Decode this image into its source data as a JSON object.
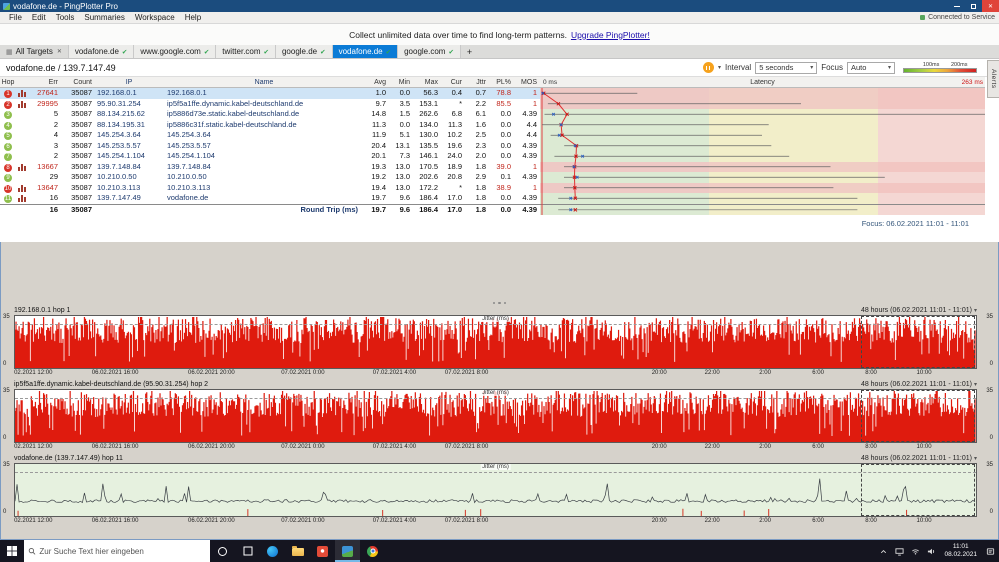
{
  "window": {
    "title": "vodafone.de - PingPlotter Pro",
    "connection_status": "Connected to Service"
  },
  "icons": {
    "close": "✕",
    "check": "✔",
    "caret": "▾",
    "grid": "▦"
  },
  "menu": [
    "File",
    "Edit",
    "Tools",
    "Summaries",
    "Workspace",
    "Help"
  ],
  "banner": {
    "text": "Collect unlimited data over time to find long-term patterns.",
    "link": "Upgrade PingPlotter!"
  },
  "tabs": {
    "all_targets": "All Targets",
    "add_label": "+",
    "items": [
      {
        "label": "vodafone.de",
        "active": false
      },
      {
        "label": "www.google.com",
        "active": false
      },
      {
        "label": "twitter.com",
        "active": false
      },
      {
        "label": "google.de",
        "active": false
      },
      {
        "label": "vodafone.de",
        "active": true
      },
      {
        "label": "google.com",
        "active": false
      }
    ]
  },
  "target": {
    "title": "vodafone.de / 139.7.147.49",
    "interval_label": "Interval",
    "interval_value": "5 seconds",
    "focus_label": "Focus",
    "focus_value": "Auto",
    "legend_100": "100ms",
    "legend_200": "200ms",
    "alerts_tab": "Alerts"
  },
  "table": {
    "headers": [
      "Hop",
      "Err",
      "Count",
      "IP",
      "Name",
      "Avg",
      "Min",
      "Max",
      "Cur",
      "Jttr",
      "PL%",
      "MOS"
    ],
    "latency_header": {
      "title": "Latency",
      "min_label": "0 ms",
      "max_label": "263 ms"
    },
    "scale_max_ms": 263,
    "rows": [
      {
        "hop": "1",
        "err": "27641",
        "count": "35087",
        "ip": "192.168.0.1",
        "name": "192.168.0.1",
        "avg": "1.0",
        "min": "0.0",
        "max": "56.3",
        "cur": "0.4",
        "jttr": "0.7",
        "pl": "78.8",
        "mos": "1",
        "n": [
          1.0,
          0.0,
          56.3,
          0.4
        ],
        "badge": "bad",
        "err_alert": true,
        "pl_alert": true,
        "mos_alert": true,
        "graph_icon": true,
        "tint": true,
        "selected": true
      },
      {
        "hop": "2",
        "err": "29995",
        "count": "35087",
        "ip": "95.90.31.254",
        "name": "ip5f5a1ffe.dynamic.kabel-deutschland.de",
        "avg": "9.7",
        "min": "3.5",
        "max": "153.1",
        "cur": "*",
        "jttr": "2.2",
        "pl": "85.5",
        "mos": "1",
        "n": [
          9.7,
          3.5,
          153.1,
          null
        ],
        "badge": "bad",
        "err_alert": true,
        "pl_alert": true,
        "mos_alert": true,
        "graph_icon": true,
        "tint": true,
        "selected": false
      },
      {
        "hop": "3",
        "err": "5",
        "count": "35087",
        "ip": "88.134.215.62",
        "name": "ip5886d73e.static.kabel-deutschland.de",
        "avg": "14.8",
        "min": "1.5",
        "max": "262.6",
        "cur": "6.8",
        "jttr": "6.1",
        "pl": "0.0",
        "mos": "4.39",
        "n": [
          14.8,
          1.5,
          262.6,
          6.8
        ],
        "badge": "ok",
        "err_alert": false,
        "pl_alert": false,
        "mos_alert": false,
        "graph_icon": false,
        "tint": false,
        "selected": false
      },
      {
        "hop": "4",
        "err": "2",
        "count": "35087",
        "ip": "88.134.195.31",
        "name": "ip5886c31f.static.kabel-deutschland.de",
        "avg": "11.3",
        "min": "0.0",
        "max": "134.0",
        "cur": "11.3",
        "jttr": "1.6",
        "pl": "0.0",
        "mos": "4.4",
        "n": [
          11.3,
          0.0,
          134.0,
          11.3
        ],
        "badge": "ok",
        "err_alert": false,
        "pl_alert": false,
        "mos_alert": false,
        "graph_icon": false,
        "tint": false,
        "selected": false
      },
      {
        "hop": "5",
        "err": "4",
        "count": "35087",
        "ip": "145.254.3.64",
        "name": "145.254.3.64",
        "avg": "11.9",
        "min": "5.1",
        "max": "130.0",
        "cur": "10.2",
        "jttr": "2.5",
        "pl": "0.0",
        "mos": "4.4",
        "n": [
          11.9,
          5.1,
          130.0,
          10.2
        ],
        "badge": "ok",
        "err_alert": false,
        "pl_alert": false,
        "mos_alert": false,
        "graph_icon": false,
        "tint": false,
        "selected": false
      },
      {
        "hop": "6",
        "err": "3",
        "count": "35087",
        "ip": "145.253.5.57",
        "name": "145.253.5.57",
        "avg": "20.4",
        "min": "13.1",
        "max": "135.5",
        "cur": "19.6",
        "jttr": "2.3",
        "pl": "0.0",
        "mos": "4.39",
        "n": [
          20.4,
          13.1,
          135.5,
          19.6
        ],
        "badge": "ok",
        "err_alert": false,
        "pl_alert": false,
        "mos_alert": false,
        "graph_icon": false,
        "tint": false,
        "selected": false
      },
      {
        "hop": "7",
        "err": "2",
        "count": "35087",
        "ip": "145.254.1.104",
        "name": "145.254.1.104",
        "avg": "20.1",
        "min": "7.3",
        "max": "146.1",
        "cur": "24.0",
        "jttr": "2.0",
        "pl": "0.0",
        "mos": "4.39",
        "n": [
          20.1,
          7.3,
          146.1,
          24.0
        ],
        "badge": "ok",
        "err_alert": false,
        "pl_alert": false,
        "mos_alert": false,
        "graph_icon": false,
        "tint": false,
        "selected": false
      },
      {
        "hop": "8",
        "err": "13667",
        "count": "35087",
        "ip": "139.7.148.84",
        "name": "139.7.148.84",
        "avg": "19.3",
        "min": "13.0",
        "max": "170.5",
        "cur": "18.9",
        "jttr": "1.8",
        "pl": "39.0",
        "mos": "1",
        "n": [
          19.3,
          13.0,
          170.5,
          18.9
        ],
        "badge": "bad",
        "err_alert": true,
        "pl_alert": true,
        "mos_alert": true,
        "graph_icon": true,
        "tint": true,
        "selected": false
      },
      {
        "hop": "9",
        "err": "29",
        "count": "35087",
        "ip": "10.210.0.50",
        "name": "10.210.0.50",
        "avg": "19.2",
        "min": "13.0",
        "max": "202.6",
        "cur": "20.8",
        "jttr": "2.9",
        "pl": "0.1",
        "mos": "4.39",
        "n": [
          19.2,
          13.0,
          202.6,
          20.8
        ],
        "badge": "ok",
        "err_alert": false,
        "pl_alert": false,
        "mos_alert": false,
        "graph_icon": false,
        "tint": false,
        "selected": false
      },
      {
        "hop": "10",
        "err": "13647",
        "count": "35087",
        "ip": "10.210.3.113",
        "name": "10.210.3.113",
        "avg": "19.4",
        "min": "13.0",
        "max": "172.2",
        "cur": "*",
        "jttr": "1.8",
        "pl": "38.9",
        "mos": "1",
        "n": [
          19.4,
          13.0,
          172.2,
          null
        ],
        "badge": "bad",
        "err_alert": true,
        "pl_alert": true,
        "mos_alert": true,
        "graph_icon": true,
        "tint": true,
        "selected": false
      },
      {
        "hop": "11",
        "err": "16",
        "count": "35087",
        "ip": "139.7.147.49",
        "name": "vodafone.de",
        "avg": "19.7",
        "min": "9.6",
        "max": "186.4",
        "cur": "17.0",
        "jttr": "1.8",
        "pl": "0.0",
        "mos": "4.39",
        "n": [
          19.7,
          9.6,
          186.4,
          17.0
        ],
        "badge": "ok",
        "err_alert": false,
        "pl_alert": false,
        "mos_alert": false,
        "graph_icon": true,
        "tint": false,
        "selected": false
      }
    ],
    "roundtrip": {
      "err": "16",
      "count": "35087",
      "label": "Round Trip (ms)",
      "avg": "19.7",
      "min": "9.6",
      "max": "186.4",
      "cur": "17.0",
      "jttr": "1.8",
      "pl": "0.0",
      "mos": "4.39",
      "n": [
        19.7,
        9.6,
        186.4,
        17.0
      ]
    },
    "focus_caption": "Focus: 06.02.2021 11:01 - 11:01"
  },
  "timelines": {
    "range_label": "48 hours (06.02.2021 11:01 - 11:01)",
    "overlay_label": "Jitter (ms)",
    "yticks": [
      "35",
      "0"
    ],
    "xlabels": [
      {
        "text": "02.2021 12:00",
        "pct": 2
      },
      {
        "text": "06.02.2021 16:00",
        "pct": 10.5
      },
      {
        "text": "06.02.2021 20:00",
        "pct": 20.5
      },
      {
        "text": "07.02.2021 0:00",
        "pct": 30
      },
      {
        "text": "07.02.2021 4:00",
        "pct": 39.5
      },
      {
        "text": "07.02.2021 8:00",
        "pct": 47
      },
      {
        "text": "20:00",
        "pct": 67
      },
      {
        "text": "22:00",
        "pct": 72.5
      },
      {
        "text": "2:00",
        "pct": 78
      },
      {
        "text": "6:00",
        "pct": 83.5
      },
      {
        "text": "8:00",
        "pct": 89
      },
      {
        "text": "10:00",
        "pct": 94.5
      }
    ],
    "graphs": [
      {
        "label": "192.168.0.1 hop 1",
        "style": "loss",
        "seed": 11
      },
      {
        "label": "ip5f5a1ffe.dynamic.kabel-deutschland.de (95.90.31.254) hop 2",
        "style": "loss",
        "seed": 22
      },
      {
        "label": "vodafone.de (139.7.147.49) hop 11",
        "style": "normal",
        "seed": 33
      }
    ]
  },
  "taskbar": {
    "search_placeholder": "Zur Suche Text hier eingeben",
    "clock_time": "11:01",
    "clock_date": "08.02.2021"
  }
}
